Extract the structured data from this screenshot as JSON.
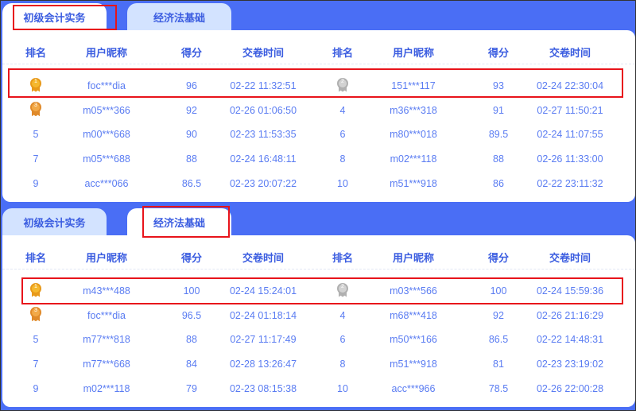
{
  "headers": [
    "排名",
    "用户昵称",
    "得分",
    "交卷时间",
    "排名",
    "用户昵称",
    "得分",
    "交卷时间"
  ],
  "colors": {
    "background": "#4a6ef5",
    "gold": "#f5a623",
    "silver": "#c9c9c9",
    "bronze": "#f0a040",
    "highlight": "#e8141b"
  },
  "panels": [
    {
      "tabs": [
        "初级会计实务",
        "经济法基础"
      ],
      "active_tab": 0,
      "rows": [
        [
          {
            "rank": "1",
            "name": "foc***dia",
            "score": "96",
            "time": "02-22 11:32:51"
          },
          {
            "rank": "2",
            "name": "151***117",
            "score": "93",
            "time": "02-24 22:30:04"
          }
        ],
        [
          {
            "rank": "3",
            "name": "m05***366",
            "score": "92",
            "time": "02-26 01:06:50"
          },
          {
            "rank": "4",
            "name": "m36***318",
            "score": "91",
            "time": "02-27 11:50:21"
          }
        ],
        [
          {
            "rank": "5",
            "name": "m00***668",
            "score": "90",
            "time": "02-23 11:53:35"
          },
          {
            "rank": "6",
            "name": "m80***018",
            "score": "89.5",
            "time": "02-24 11:07:55"
          }
        ],
        [
          {
            "rank": "7",
            "name": "m05***688",
            "score": "88",
            "time": "02-24 16:48:11"
          },
          {
            "rank": "8",
            "name": "m02***118",
            "score": "88",
            "time": "02-26 11:33:00"
          }
        ],
        [
          {
            "rank": "9",
            "name": "acc***066",
            "score": "86.5",
            "time": "02-23 20:07:22"
          },
          {
            "rank": "10",
            "name": "m51***918",
            "score": "86",
            "time": "02-22 23:11:32"
          }
        ]
      ]
    },
    {
      "tabs": [
        "初级会计实务",
        "经济法基础"
      ],
      "active_tab": 1,
      "rows": [
        [
          {
            "rank": "1",
            "name": "m43***488",
            "score": "100",
            "time": "02-24 15:24:01"
          },
          {
            "rank": "2",
            "name": "m03***566",
            "score": "100",
            "time": "02-24 15:59:36"
          }
        ],
        [
          {
            "rank": "3",
            "name": "foc***dia",
            "score": "96.5",
            "time": "02-24 01:18:14"
          },
          {
            "rank": "4",
            "name": "m68***418",
            "score": "92",
            "time": "02-26 21:16:29"
          }
        ],
        [
          {
            "rank": "5",
            "name": "m77***818",
            "score": "88",
            "time": "02-27 11:17:49"
          },
          {
            "rank": "6",
            "name": "m50***166",
            "score": "86.5",
            "time": "02-22 14:48:31"
          }
        ],
        [
          {
            "rank": "7",
            "name": "m77***668",
            "score": "84",
            "time": "02-28 13:26:47"
          },
          {
            "rank": "8",
            "name": "m51***918",
            "score": "81",
            "time": "02-23 23:19:02"
          }
        ],
        [
          {
            "rank": "9",
            "name": "m02***118",
            "score": "79",
            "time": "02-23 08:15:38"
          },
          {
            "rank": "10",
            "name": "acc***966",
            "score": "78.5",
            "time": "02-26 22:00:28"
          }
        ]
      ]
    }
  ]
}
